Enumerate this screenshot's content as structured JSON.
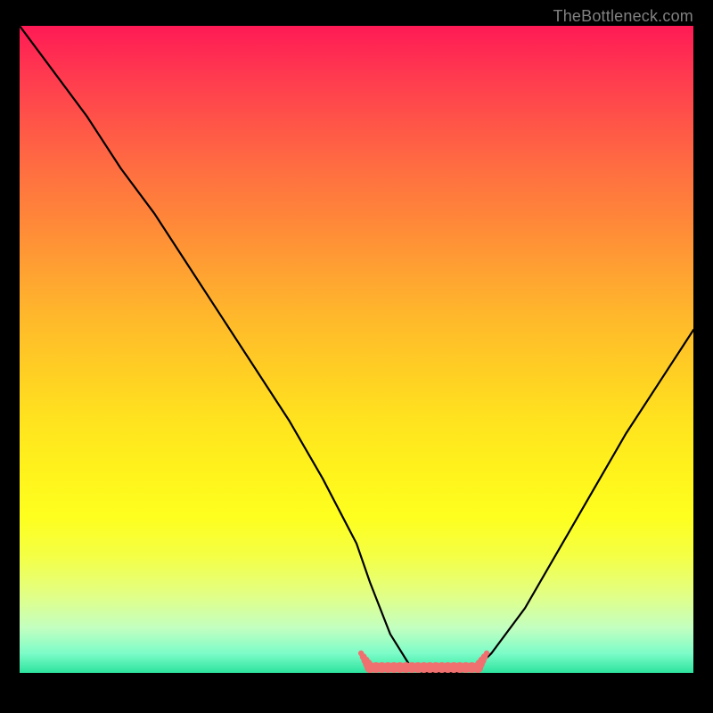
{
  "watermark": "TheBottleneck.com",
  "colors": {
    "background": "#000000",
    "curve": "#000000",
    "marker": "#f07070",
    "gradient_top": "#ff1a55",
    "gradient_bottom": "#2de39e"
  },
  "chart_data": {
    "type": "line",
    "title": "",
    "xlabel": "",
    "ylabel": "",
    "xlim": [
      0,
      100
    ],
    "ylim": [
      0,
      100
    ],
    "legend": false,
    "grid": false,
    "series": [
      {
        "name": "bottleneck-curve",
        "x": [
          0,
          5,
          10,
          15,
          20,
          25,
          30,
          35,
          40,
          45,
          50,
          52,
          55,
          58,
          60,
          63,
          65,
          68,
          70,
          75,
          80,
          85,
          90,
          95,
          100
        ],
        "values": [
          100,
          93,
          86,
          78,
          71,
          63,
          55,
          47,
          39,
          30,
          20,
          14,
          6,
          1,
          0,
          0,
          0,
          1,
          3,
          10,
          19,
          28,
          37,
          45,
          53
        ]
      }
    ],
    "annotations": [
      {
        "name": "valley-marker",
        "x_range": [
          52,
          68
        ],
        "y": 0,
        "color": "#f07070",
        "style": "thick-dotted"
      }
    ]
  }
}
